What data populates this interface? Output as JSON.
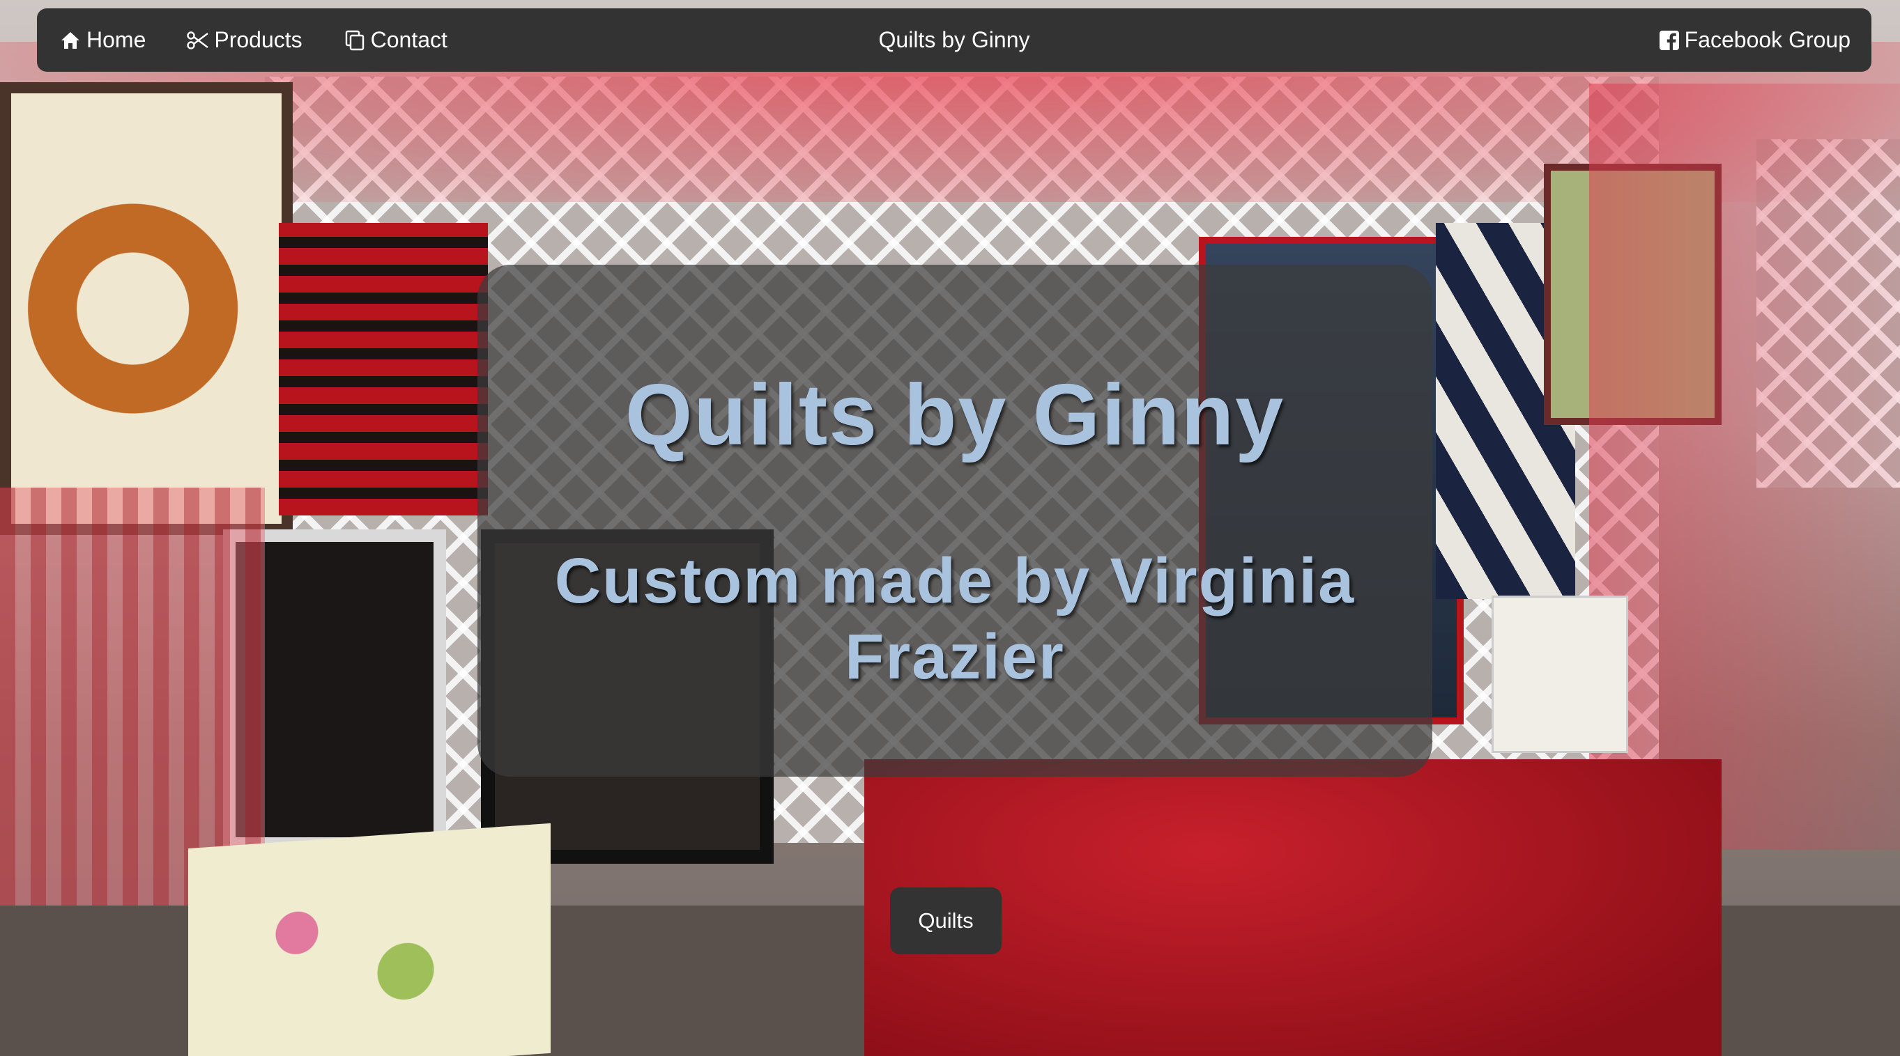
{
  "navbar": {
    "home_label": "Home",
    "products_label": "Products",
    "contact_label": "Contact",
    "brand_title": "Quilts by Ginny",
    "facebook_label": "Facebook Group",
    "icons": {
      "home": "home-icon",
      "products": "scissors-icon",
      "contact": "copy-icon",
      "facebook": "facebook-square-icon"
    }
  },
  "hero": {
    "title": "Quilts by Ginny",
    "subtitle": "Custom made by Virginia Frazier"
  },
  "quilts_button": {
    "label": "Quilts"
  },
  "colors": {
    "navbar_bg": "#333333",
    "nav_text": "#ffffff",
    "hero_text": "#a9c2dd",
    "hero_panel": "rgba(60,60,60,0.72)"
  }
}
